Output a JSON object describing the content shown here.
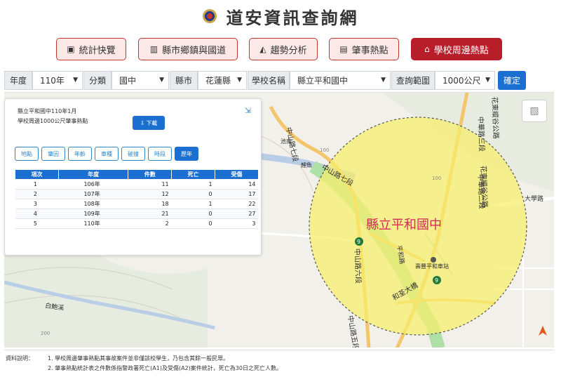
{
  "header": {
    "title": "道安資訊查詢網",
    "logo_icon": "police-emblem-icon"
  },
  "nav": [
    {
      "label": "統計快覽",
      "icon": "id-card-icon",
      "active": false
    },
    {
      "label": "縣市鄉鎮與國道",
      "icon": "bar-chart-icon",
      "active": false
    },
    {
      "label": "趨勢分析",
      "icon": "area-chart-icon",
      "active": false
    },
    {
      "label": "肇事熱點",
      "icon": "map-icon",
      "active": false
    },
    {
      "label": "學校周邊熱點",
      "icon": "school-icon",
      "active": true
    }
  ],
  "filters": {
    "year_label": "年度",
    "year_value": "110年",
    "category_label": "分類",
    "category_value": "國中",
    "county_label": "縣市",
    "county_value": "花蓮縣",
    "school_label": "學校名稱",
    "school_value": "縣立平和國中",
    "range_label": "查詢範圍",
    "range_value": "1000公尺",
    "confirm_label": "確定"
  },
  "panel": {
    "line1": "縣立平和國中110年1月",
    "line2": "學校周邊1000公尺肇事熱點",
    "download_label": "下載",
    "tabs": [
      "地點",
      "肇因",
      "年齡",
      "車種",
      "碰撞",
      "時段",
      "歷年"
    ],
    "active_tab": "歷年",
    "table": {
      "headers": [
        "項次",
        "年度",
        "件數",
        "死亡",
        "受傷"
      ],
      "rows": [
        [
          "1",
          "106年",
          "11",
          "1",
          "14"
        ],
        [
          "2",
          "107年",
          "12",
          "0",
          "17"
        ],
        [
          "3",
          "108年",
          "18",
          "1",
          "22"
        ],
        [
          "4",
          "109年",
          "21",
          "0",
          "27"
        ],
        [
          "5",
          "110年",
          "2",
          "0",
          "3"
        ]
      ]
    }
  },
  "map": {
    "school_label": "縣立平和國中",
    "circle_color": "#f7ef6a",
    "labels": {
      "zhongshan7": "中山路七段",
      "zhongshan6": "中山路六段",
      "zhongshan5": "中山路五段",
      "zhonghua3": "中華路三段",
      "zhonghua2": "中華路二段",
      "huadong_road": "花東縱谷公路",
      "daxue": "大學路",
      "heping": "平和路",
      "station": "壽豐平和車站",
      "hejiu": "和荃大橋",
      "baijiao": "白鮑溪",
      "chiliang": "池南",
      "liyu": "鯉魚",
      "sign9a": "9",
      "sign9b": "9",
      "n100a": "100",
      "n100b": "100",
      "n200": "200"
    }
  },
  "notes": {
    "label": "資料說明：",
    "line1": "1. 學校周邊肇事熱點其事故案件並非僅該校學生，乃包含其餘一般民眾。",
    "line2": "2. 肇事熱點統計表之件數係指警政署死亡(A1)及受傷(A2)案件統計，死亡為30日之死亡人數。"
  }
}
